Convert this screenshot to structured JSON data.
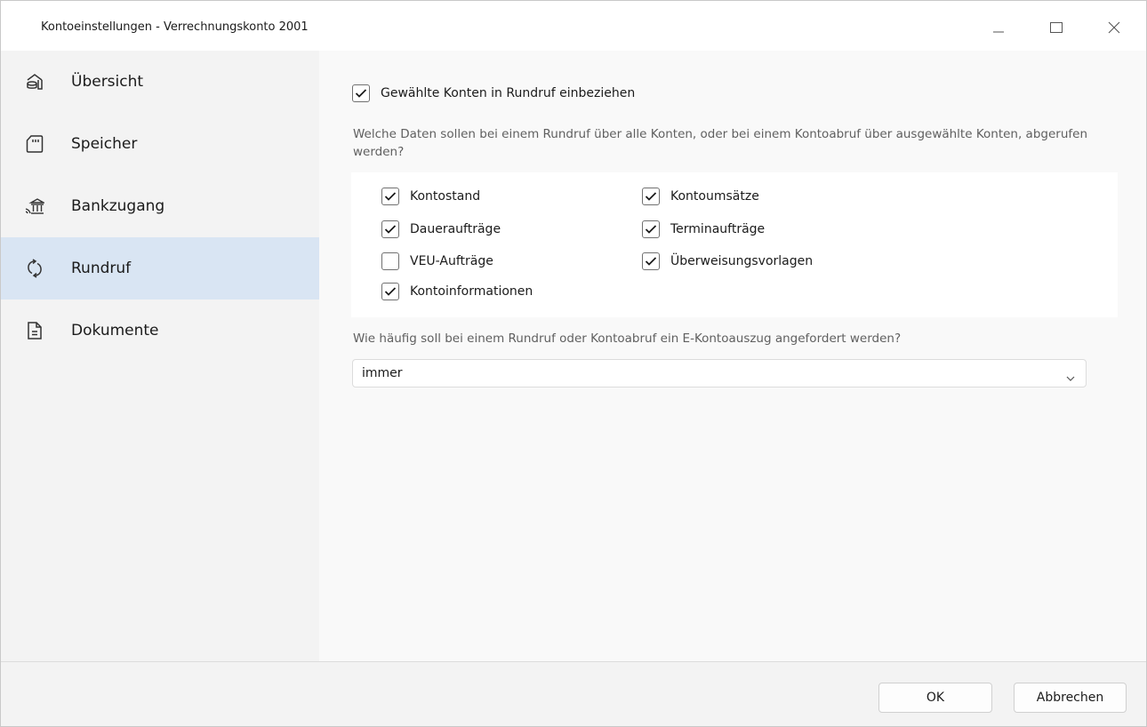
{
  "window": {
    "title": "Kontoeinstellungen - Verrechnungskonto 2001"
  },
  "sidebar": {
    "items": [
      {
        "label": "Übersicht",
        "icon": "overview-icon",
        "active": false
      },
      {
        "label": "Speicher",
        "icon": "sd-card-icon",
        "active": false
      },
      {
        "label": "Bankzugang",
        "icon": "bank-icon",
        "active": false
      },
      {
        "label": "Rundruf",
        "icon": "refresh-icon",
        "active": true
      },
      {
        "label": "Dokumente",
        "icon": "document-icon",
        "active": false
      }
    ]
  },
  "main": {
    "include_checkbox": {
      "label": "Gewählte Konten in Rundruf einbeziehen",
      "checked": true
    },
    "description": "Welche Daten sollen bei einem Rundruf über alle Konten, oder bei einem Kontoabruf über ausgewählte Konten, abgerufen werden?",
    "data_options": [
      {
        "label": "Kontostand",
        "checked": true
      },
      {
        "label": "Kontoumsätze",
        "checked": true
      },
      {
        "label": "Daueraufträge",
        "checked": true
      },
      {
        "label": "Terminaufträge",
        "checked": true
      },
      {
        "label": "VEU-Aufträge",
        "checked": false
      },
      {
        "label": "Überweisungsvorlagen",
        "checked": true
      },
      {
        "label": "Kontoinformationen",
        "checked": true
      }
    ],
    "frequency_question": "Wie häufig soll bei einem Rundruf oder Kontoabruf ein E-Kontoauszug angefordert werden?",
    "frequency_value": "immer"
  },
  "footer": {
    "ok_label": "OK",
    "cancel_label": "Abbrechen"
  },
  "colors": {
    "active_nav": "#d9e5f3",
    "sidebar_bg": "#f3f3f3",
    "content_bg": "#f9f9f9",
    "panel_bg": "#ffffff"
  }
}
